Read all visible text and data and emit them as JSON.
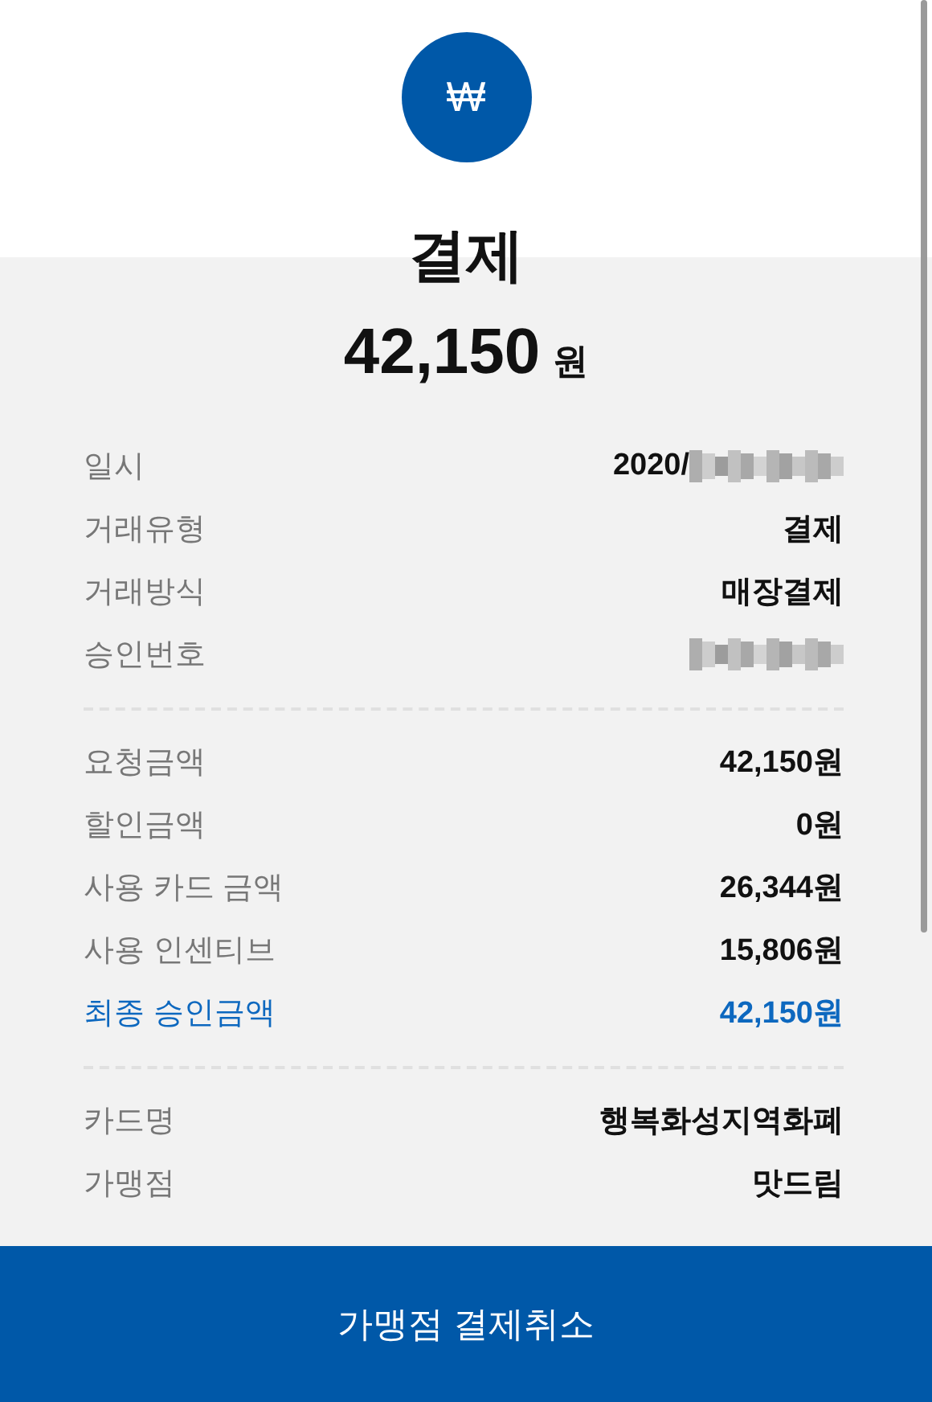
{
  "header": {
    "currency_symbol": "₩",
    "title": "결제",
    "amount": "42,150",
    "unit": "원"
  },
  "sections": [
    {
      "rows": [
        {
          "label": "일시",
          "value": "2020/",
          "redacted": true,
          "highlighted": false
        },
        {
          "label": "거래유형",
          "value": "결제",
          "redacted": false,
          "highlighted": false
        },
        {
          "label": "거래방식",
          "value": "매장결제",
          "redacted": false,
          "highlighted": false
        },
        {
          "label": "승인번호",
          "redacted": true,
          "highlighted": false
        }
      ]
    },
    {
      "rows": [
        {
          "label": "요청금액",
          "value": "42,150원",
          "redacted": false,
          "highlighted": false
        },
        {
          "label": "할인금액",
          "value": "0원",
          "redacted": false,
          "highlighted": false
        },
        {
          "label": "사용 카드 금액",
          "value": "26,344원",
          "redacted": false,
          "highlighted": false
        },
        {
          "label": "사용 인센티브",
          "value": "15,806원",
          "redacted": false,
          "highlighted": false
        },
        {
          "label": "최종 승인금액",
          "value": "42,150원",
          "redacted": false,
          "highlighted": true
        }
      ]
    },
    {
      "rows": [
        {
          "label": "카드명",
          "value": "행복화성지역화폐",
          "redacted": false,
          "highlighted": false
        },
        {
          "label": "가맹점",
          "value": "맛드림",
          "redacted": false,
          "highlighted": false
        }
      ]
    }
  ],
  "action_button": "가맹점 결제취소"
}
